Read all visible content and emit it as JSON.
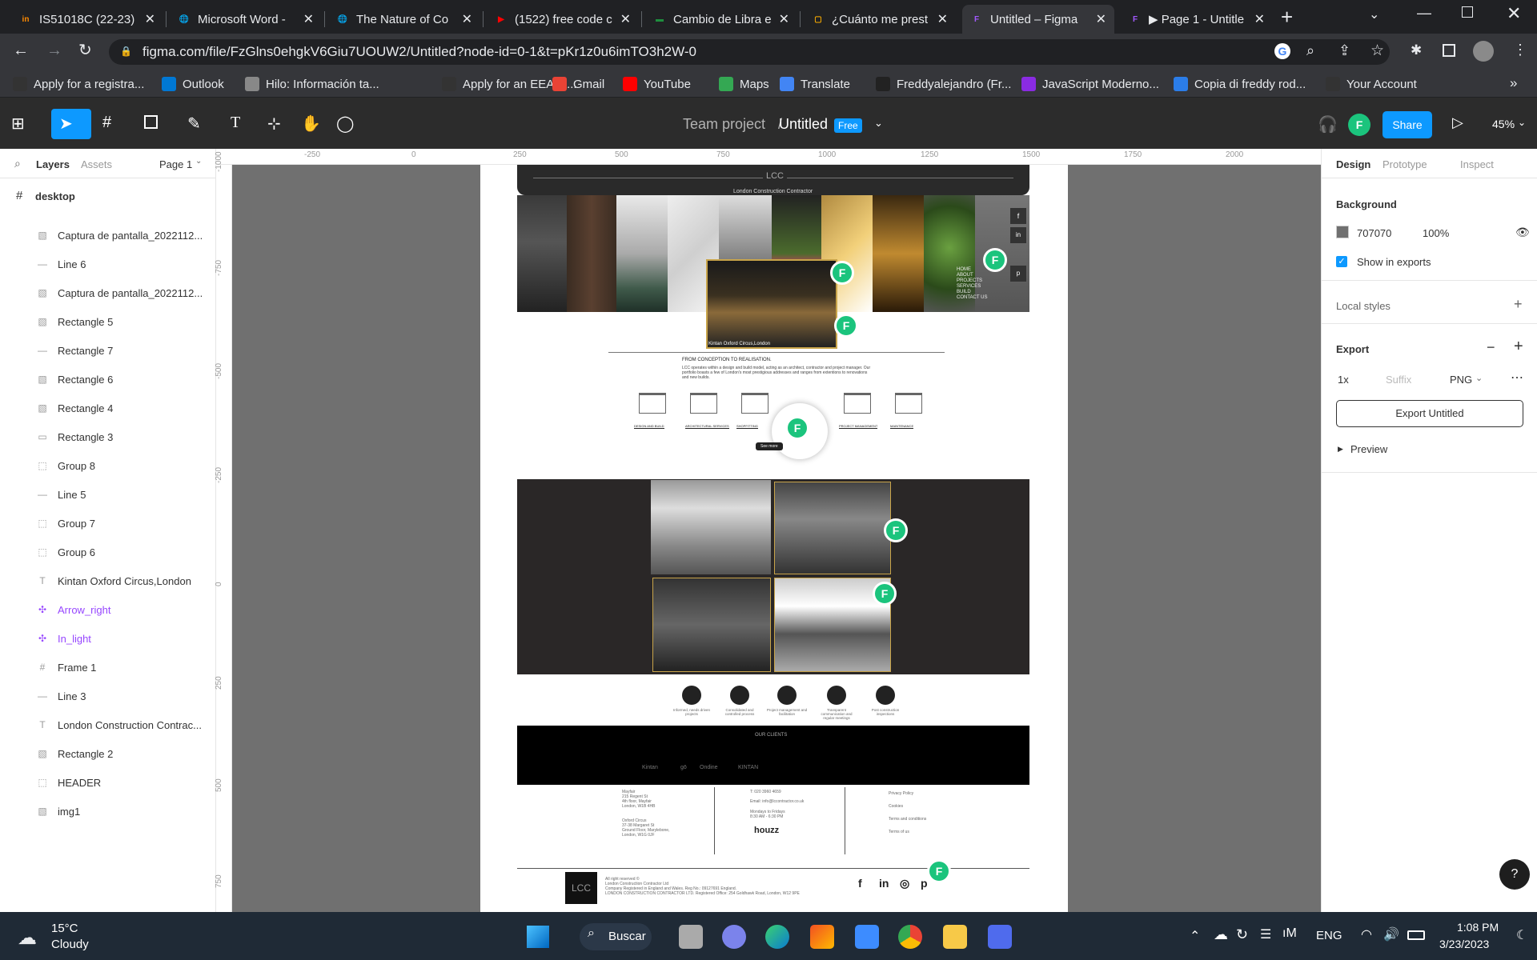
{
  "browser": {
    "tabs": [
      {
        "label": "IS51018C (22-23)",
        "fav": "in",
        "color": "#ff8a00"
      },
      {
        "label": "Microsoft Word -",
        "fav": "🌐",
        "color": "#5f6368"
      },
      {
        "label": "The Nature of Co",
        "fav": "🌐",
        "color": "#5f6368"
      },
      {
        "label": "(1522) free code c",
        "fav": "▶",
        "color": "#ff0000"
      },
      {
        "label": "Cambio de Libra e",
        "fav": "▬",
        "color": "#1e8e3e"
      },
      {
        "label": "¿Cuánto me prest",
        "fav": "▢",
        "color": "#f9ab00"
      },
      {
        "label": "Untitled – Figma",
        "fav": "F",
        "color": "#a259ff"
      },
      {
        "label": "▶ Page 1 - Untitle",
        "fav": "F",
        "color": "#a259ff"
      }
    ],
    "url": "figma.com/file/FzGlns0ehgkV6Giu7UOUW2/Untitled?node-id=0-1&t=pKr1z0u6imTO3h2W-0",
    "bookmarks": [
      "Apply for a registra...",
      "Outlook",
      "Hilo: Información ta...",
      "Apply for an EEA fa...",
      "Gmail",
      "YouTube",
      "Maps",
      "Translate",
      "Freddyalejandro (Fr...",
      "JavaScript Moderno...",
      "Copia di freddy rod...",
      "Your Account"
    ],
    "more_bookmarks": "»"
  },
  "figma": {
    "project": "Team project",
    "separator": "/",
    "file": "Untitled",
    "plan_badge": "Free",
    "share_label": "Share",
    "user_initial": "F",
    "zoom": "45%",
    "left_tabs": {
      "layers": "Layers",
      "assets": "Assets",
      "page": "Page 1"
    },
    "frame_name": "desktop",
    "layers": [
      {
        "name": "Captura de pantalla_2022112...",
        "icon": "image"
      },
      {
        "name": "Line 6",
        "icon": "line"
      },
      {
        "name": "Captura de pantalla_2022112...",
        "icon": "image"
      },
      {
        "name": "Rectangle 5",
        "icon": "image"
      },
      {
        "name": "Rectangle 7",
        "icon": "line"
      },
      {
        "name": "Rectangle 6",
        "icon": "image"
      },
      {
        "name": "Rectangle 4",
        "icon": "image"
      },
      {
        "name": "Rectangle 3",
        "icon": "rect"
      },
      {
        "name": "Group 8",
        "icon": "group"
      },
      {
        "name": "Line 5",
        "icon": "line"
      },
      {
        "name": "Group 7",
        "icon": "group"
      },
      {
        "name": "Group 6",
        "icon": "group"
      },
      {
        "name": "Kintan Oxford Circus,London",
        "icon": "text"
      },
      {
        "name": "Arrow_right",
        "icon": "component"
      },
      {
        "name": "In_light",
        "icon": "component"
      },
      {
        "name": "Frame 1",
        "icon": "frame"
      },
      {
        "name": "Line 3",
        "icon": "line"
      },
      {
        "name": "London Construction Contrac...",
        "icon": "text"
      },
      {
        "name": "Rectangle 2",
        "icon": "image"
      },
      {
        "name": "HEADER",
        "icon": "group"
      },
      {
        "name": "img1",
        "icon": "image"
      }
    ],
    "right_tabs": {
      "design": "Design",
      "prototype": "Prototype",
      "inspect": "Inspect"
    },
    "background": {
      "title": "Background",
      "hex": "707070",
      "opacity": "100%",
      "show_in_exports": "Show in exports"
    },
    "local_styles": "Local styles",
    "export": {
      "title": "Export",
      "scale": "1x",
      "suffix_placeholder": "Suffix",
      "format": "PNG",
      "button": "Export Untitled",
      "preview": "Preview"
    },
    "help": "?",
    "ruler_x": [
      "-250",
      "0",
      "250",
      "500",
      "750",
      "1000",
      "1250",
      "1500",
      "1750",
      "2000"
    ],
    "ruler_y": [
      "-1000",
      "-750",
      "-500",
      "-250",
      "0",
      "250",
      "500",
      "750"
    ]
  },
  "design": {
    "logo": "LCC",
    "tagline": "London Construction Contractor",
    "caption": "Kintan Oxford Circus,London",
    "section_title": "FROM CONCEPTION TO REALISATION.",
    "section_body": "LCC operates within a design and build model, acting as an architect, contractor and project manager. Our portfolio boasts a few of London's most prestigious addresses and ranges from extentions to renovations and new builds.",
    "nav": [
      "HOME",
      "ABOUT",
      "PROJECTS",
      "SERVICES",
      "BUILD",
      "CONTACT US"
    ],
    "services": [
      "DESIGN AND BUILD",
      "ARCHITECTURAL SERVICES",
      "SHOPFITTING",
      "",
      "PROJECT MANAGEMENT",
      "MAINTENANCE"
    ],
    "see_more": "See more",
    "features": [
      "Informed, needs driven projects",
      "Consolidated and controlled process",
      "Project management and facilitation",
      "Transparent communication and regular meetings",
      "Post construction inspections"
    ],
    "clients_title": "OUR CLIENTS",
    "client_logos": [
      "Kintan",
      "",
      "gō",
      "Ondine",
      "",
      "KINTAN",
      "",
      "",
      "",
      "",
      "",
      ""
    ],
    "footer_addr1": [
      "Mayfair",
      "215 Regent St",
      "4th floor, Mayfair",
      "London, W1B 4HB"
    ],
    "footer_addr2": [
      "Oxford Circus",
      "37-38 Margaret St",
      "Ground Floor, Marylebone,",
      "London, W1G 0JF"
    ],
    "footer_contact": [
      "T: 020 3960 4659",
      "Email: info@lccontractor.co.uk",
      "Mondays to Fridays",
      "8:30 AM - 6:30 PM"
    ],
    "houzz": "houzz",
    "footer_links": [
      "Privacy Policy",
      "Cookies",
      "Terms and conditions",
      "Terms of us"
    ],
    "copyright": [
      "All right reserved ©",
      "London Construction Contractor Ltd",
      "Company Registered in England and Wales. Reg No.: 09127691 England.",
      "LONDON CONSTRUCTION CONTRACTOR LTD. Registered Office: 254 Goldhawk Road, London, W12 9PE"
    ],
    "social": [
      "f",
      "in",
      "◎",
      "p"
    ]
  },
  "taskbar": {
    "temp": "15°C",
    "weather": "Cloudy",
    "search": "Buscar",
    "lang": "ENG",
    "time": "1:08 PM",
    "date": "3/23/2023"
  }
}
